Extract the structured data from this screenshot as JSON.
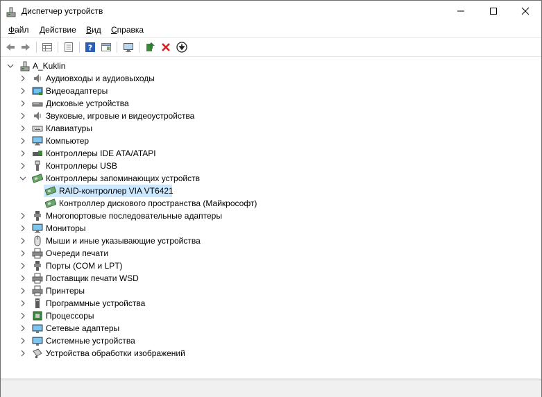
{
  "window": {
    "title": "Диспетчер устройств"
  },
  "menu": [
    {
      "label_pre": "",
      "label_u": "Ф",
      "label_post": "айл"
    },
    {
      "label_pre": "",
      "label_u": "Д",
      "label_post": "ействие"
    },
    {
      "label_pre": "",
      "label_u": "В",
      "label_post": "ид"
    },
    {
      "label_pre": "",
      "label_u": "С",
      "label_post": "правка"
    }
  ],
  "toolbar": {
    "items": [
      "back-icon",
      "forward-icon",
      "properties-grid-icon",
      "properties-page-icon",
      "help-icon",
      "view-icon",
      "monitor-scan-icon",
      "update-driver-icon",
      "remove-icon",
      "download-icon"
    ]
  },
  "tree": {
    "root": "A_Kuklin",
    "categories": [
      {
        "label": "Аудиовходы и аудиовыходы",
        "icon": "audio-icon",
        "expanded": false
      },
      {
        "label": "Видеоадаптеры",
        "icon": "display-adapter-icon",
        "expanded": false
      },
      {
        "label": "Дисковые устройства",
        "icon": "disk-drive-icon",
        "expanded": false
      },
      {
        "label": "Звуковые, игровые и видеоустройства",
        "icon": "speaker-icon",
        "expanded": false
      },
      {
        "label": "Клавиатуры",
        "icon": "keyboard-icon",
        "expanded": false
      },
      {
        "label": "Компьютер",
        "icon": "computer-icon",
        "expanded": false
      },
      {
        "label": "Контроллеры IDE ATA/ATAPI",
        "icon": "ide-controller-icon",
        "expanded": false
      },
      {
        "label": "Контроллеры USB",
        "icon": "usb-icon",
        "expanded": false
      },
      {
        "label": "Контроллеры запоминающих устройств",
        "icon": "storage-controller-icon",
        "expanded": true,
        "children": [
          {
            "label": "RAID-контроллер VIA VT6421",
            "icon": "raid-icon",
            "selected": true
          },
          {
            "label": "Контроллер дискового пространства (Майкрософт)",
            "icon": "raid-icon",
            "selected": false
          }
        ]
      },
      {
        "label": "Многопортовые последовательные адаптеры",
        "icon": "multiport-icon",
        "expanded": false
      },
      {
        "label": "Мониторы",
        "icon": "monitor-icon",
        "expanded": false
      },
      {
        "label": "Мыши и иные указывающие устройства",
        "icon": "mouse-icon",
        "expanded": false
      },
      {
        "label": "Очереди печати",
        "icon": "print-queue-icon",
        "expanded": false
      },
      {
        "label": "Порты (COM и LPT)",
        "icon": "port-icon",
        "expanded": false
      },
      {
        "label": "Поставщик печати WSD",
        "icon": "printer-icon",
        "expanded": false
      },
      {
        "label": "Принтеры",
        "icon": "printer-icon",
        "expanded": false
      },
      {
        "label": "Программные устройства",
        "icon": "software-device-icon",
        "expanded": false
      },
      {
        "label": "Процессоры",
        "icon": "processor-icon",
        "expanded": false
      },
      {
        "label": "Сетевые адаптеры",
        "icon": "network-adapter-icon",
        "expanded": false
      },
      {
        "label": "Системные устройства",
        "icon": "system-device-icon",
        "expanded": false
      },
      {
        "label": "Устройства обработки изображений",
        "icon": "camera-icon",
        "expanded": false
      }
    ]
  }
}
